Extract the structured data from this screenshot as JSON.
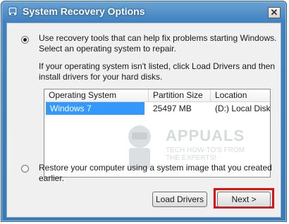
{
  "window": {
    "title": "System Recovery Options",
    "close_glyph": "✕"
  },
  "option_tools": {
    "line1": "Use recovery tools that can help fix problems starting Windows.",
    "line2": "Select an operating system to repair.",
    "info1": "If your operating system isn't listed, click Load Drivers and then",
    "info2": "install drivers for your hard disks."
  },
  "os_table": {
    "columns": [
      "Operating System",
      "Partition Size",
      "Location"
    ],
    "rows": [
      {
        "os": "Windows 7",
        "size": "25497 MB",
        "location": "(D:) Local Disk"
      }
    ]
  },
  "watermark": {
    "title": "APPUALS",
    "sub1": "TECH HOW-TO'S FROM",
    "sub2": "THE EXPERTS!"
  },
  "option_restore": {
    "line1": "Restore your computer using a system image that you created",
    "line2": "earlier."
  },
  "buttons": {
    "load_drivers": "Load Drivers",
    "next": "Next >"
  },
  "colors": {
    "title_bar": "#3f80be",
    "selection": "#3399ff",
    "highlight_box": "#e01010"
  }
}
